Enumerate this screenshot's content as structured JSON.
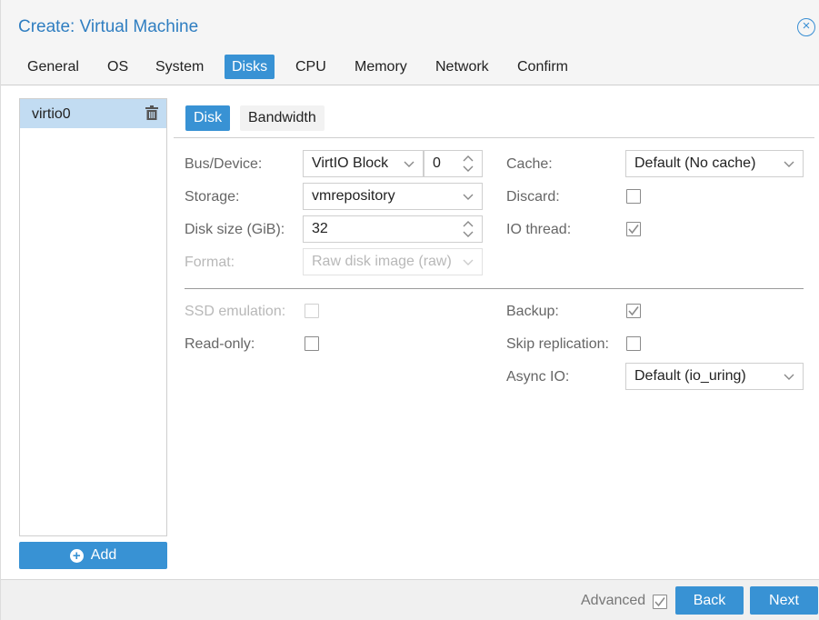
{
  "window": {
    "title": "Create: Virtual Machine"
  },
  "tabs": [
    {
      "label": "General"
    },
    {
      "label": "OS"
    },
    {
      "label": "System"
    },
    {
      "label": "Disks",
      "active": true
    },
    {
      "label": "CPU"
    },
    {
      "label": "Memory"
    },
    {
      "label": "Network"
    },
    {
      "label": "Confirm"
    }
  ],
  "disks": {
    "items": [
      {
        "label": "virtio0"
      }
    ],
    "add_label": "Add"
  },
  "subtabs": {
    "disk": "Disk",
    "bandwidth": "Bandwidth"
  },
  "form": {
    "bus_device": {
      "label": "Bus/Device:",
      "bus": "VirtIO Block",
      "device": "0"
    },
    "storage": {
      "label": "Storage:",
      "value": "vmrepository"
    },
    "disk_size": {
      "label": "Disk size (GiB):",
      "value": "32"
    },
    "format": {
      "label": "Format:",
      "value": "Raw disk image (raw)"
    },
    "cache": {
      "label": "Cache:",
      "value": "Default (No cache)"
    },
    "discard": {
      "label": "Discard:",
      "checked": false
    },
    "io_thread": {
      "label": "IO thread:",
      "checked": true
    },
    "ssd_emulation": {
      "label": "SSD emulation:",
      "checked": false
    },
    "read_only": {
      "label": "Read-only:",
      "checked": false
    },
    "backup": {
      "label": "Backup:",
      "checked": true
    },
    "skip_replication": {
      "label": "Skip replication:",
      "checked": false
    },
    "async_io": {
      "label": "Async IO:",
      "value": "Default (io_uring)"
    }
  },
  "footer": {
    "advanced_label": "Advanced",
    "advanced_checked": true,
    "back_label": "Back",
    "next_label": "Next"
  },
  "colors": {
    "accent": "#3892d4",
    "title": "#2f7ec1",
    "selected_row": "#c2dcf2"
  }
}
